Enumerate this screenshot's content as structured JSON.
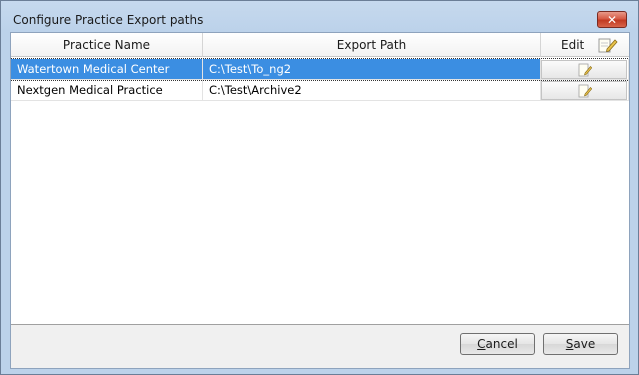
{
  "window": {
    "title": "Configure Practice Export paths",
    "close_glyph": "✕"
  },
  "grid": {
    "columns": [
      "Practice Name",
      "Export Path",
      "Edit"
    ],
    "rows": [
      {
        "name": "Watertown Medical Center",
        "path": "C:\\Test\\To_ng2",
        "selected": true
      },
      {
        "name": "Nextgen Medical Practice",
        "path": "C:\\Test\\Archive2",
        "selected": false
      }
    ]
  },
  "buttons": {
    "cancel": {
      "mnemonic": "C",
      "rest": "ancel"
    },
    "save": {
      "mnemonic": "S",
      "rest": "ave"
    }
  },
  "colors": {
    "selection": "#3b8ee2",
    "title_bar": "#bcd2ea"
  },
  "icons": {
    "edit_all": "edit-all-icon",
    "edit_row": "pencil-edit-icon",
    "close": "close-icon"
  }
}
